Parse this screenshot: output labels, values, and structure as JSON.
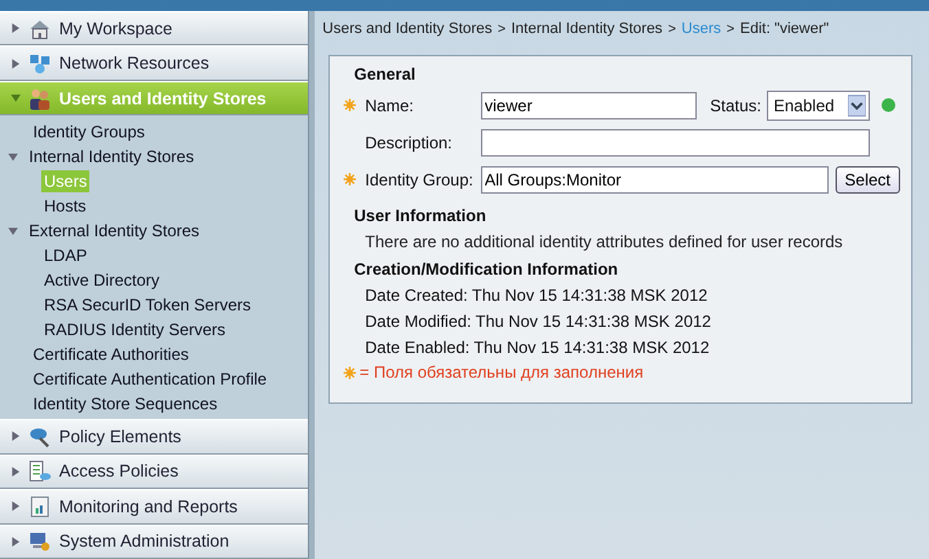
{
  "sidebar": {
    "sections_top": [
      {
        "label": "My Workspace",
        "kind": "home",
        "expanded": false
      },
      {
        "label": "Network Resources",
        "kind": "network",
        "expanded": false
      },
      {
        "label": "Users and Identity Stores",
        "kind": "users",
        "expanded": true
      }
    ],
    "tree": [
      {
        "label": "Identity Groups",
        "selected": false
      },
      {
        "label": "Internal Identity Stores",
        "selected": false,
        "expanded": true,
        "children": [
          {
            "label": "Users",
            "selected": true
          },
          {
            "label": "Hosts",
            "selected": false
          }
        ]
      },
      {
        "label": "External Identity Stores",
        "selected": false,
        "expanded": true,
        "children": [
          {
            "label": "LDAP",
            "selected": false
          },
          {
            "label": "Active Directory",
            "selected": false
          },
          {
            "label": "RSA SecurID Token Servers",
            "selected": false
          },
          {
            "label": "RADIUS Identity Servers",
            "selected": false
          }
        ]
      },
      {
        "label": "Certificate Authorities",
        "selected": false
      },
      {
        "label": "Certificate Authentication Profile",
        "selected": false
      },
      {
        "label": "Identity Store Sequences",
        "selected": false
      }
    ],
    "sections_bottom": [
      {
        "label": "Policy Elements",
        "kind": "policy",
        "expanded": false
      },
      {
        "label": "Access Policies",
        "kind": "access",
        "expanded": false
      },
      {
        "label": "Monitoring and Reports",
        "kind": "reports",
        "expanded": false
      },
      {
        "label": "System Administration",
        "kind": "admin",
        "expanded": false
      }
    ]
  },
  "breadcrumb": [
    {
      "label": "Users and Identity Stores",
      "kind": "text"
    },
    {
      "label": ">",
      "kind": "separator"
    },
    {
      "label": "Internal Identity Stores",
      "kind": "text"
    },
    {
      "label": ">",
      "kind": "separator"
    },
    {
      "label": "Users",
      "kind": "link"
    },
    {
      "label": ">",
      "kind": "separator"
    },
    {
      "label": "Edit: \"viewer\"",
      "kind": "text"
    }
  ],
  "form": {
    "general_title": "General",
    "name": {
      "label": "Name:",
      "value": "viewer",
      "required": true
    },
    "status": {
      "label": "Status:",
      "value": "Enabled",
      "color": "#3cb44a"
    },
    "description": {
      "label": "Description:",
      "required": false
    },
    "identity_group": {
      "label": "Identity Group:",
      "value": "All Groups:Monitor",
      "required": true,
      "button": "Select"
    },
    "user_info_title": "User Information",
    "user_info_text": "There are no additional identity attributes defined for user records",
    "creation_title": "Creation/Modification Information",
    "dates": [
      {
        "label": "Date Created:",
        "value": "Thu Nov 15 14:31:38 MSK 2012"
      },
      {
        "label": "Date Modified:",
        "value": "Thu Nov 15 14:31:38 MSK 2012"
      },
      {
        "label": "Date Enabled:",
        "value": "Thu Nov 15 14:31:38 MSK 2012"
      }
    ],
    "required_note": "= Поля обязательны для заполнения"
  }
}
